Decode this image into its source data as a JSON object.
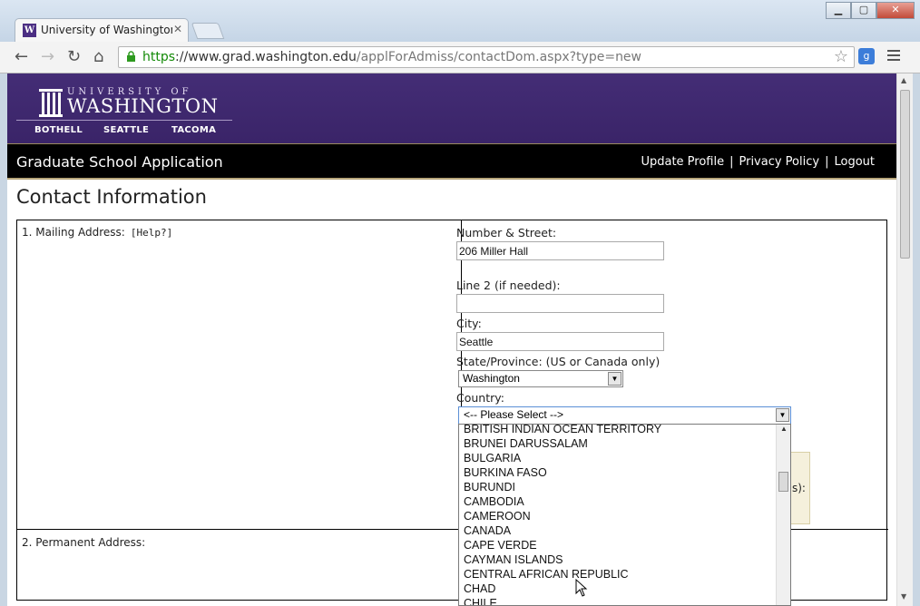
{
  "browser": {
    "tab_title": "University of Washington - ",
    "tab_favicon": "W",
    "url_scheme": "https",
    "url_host": "://www.grad.washington.edu",
    "url_path": "/applForAdmiss/contactDom.aspx?type=new",
    "ext_label": "g"
  },
  "banner": {
    "university_line": "UNIVERSITY OF",
    "washington": "WASHINGTON",
    "campuses": [
      "BOTHELL",
      "SEATTLE",
      "TACOMA"
    ]
  },
  "appbar": {
    "title": "Graduate School Application",
    "links": [
      "Update Profile",
      "Privacy Policy",
      "Logout"
    ],
    "separator": "|"
  },
  "page": {
    "heading": "Contact Information",
    "mailing_label": "1. Mailing Address:",
    "help_label": "[Help?]",
    "permanent_label": "2. Permanent Address:"
  },
  "form": {
    "street_label": "Number & Street:",
    "street_value": "206 Miller Hall",
    "line2_label": "Line 2 (if needed):",
    "line2_value": "",
    "city_label": "City:",
    "city_value": "Seattle",
    "state_label": "State/Province: (US or Canada only)",
    "state_value": "Washington",
    "country_label": "Country:",
    "country_value": "<-- Please Select -->",
    "hidden_text": "s):"
  },
  "country_options": [
    "BRITISH INDIAN OCEAN TERRITORY",
    "BRUNEI DARUSSALAM",
    "BULGARIA",
    "BURKINA FASO",
    "BURUNDI",
    "CAMBODIA",
    "CAMEROON",
    "CANADA",
    "CAPE VERDE",
    "CAYMAN ISLANDS",
    "CENTRAL AFRICAN REPUBLIC",
    "CHAD",
    "CHILE"
  ],
  "colors": {
    "uw_purple": "#3b2467",
    "uw_gold": "#b7a57a",
    "secure_green": "#138a07"
  }
}
